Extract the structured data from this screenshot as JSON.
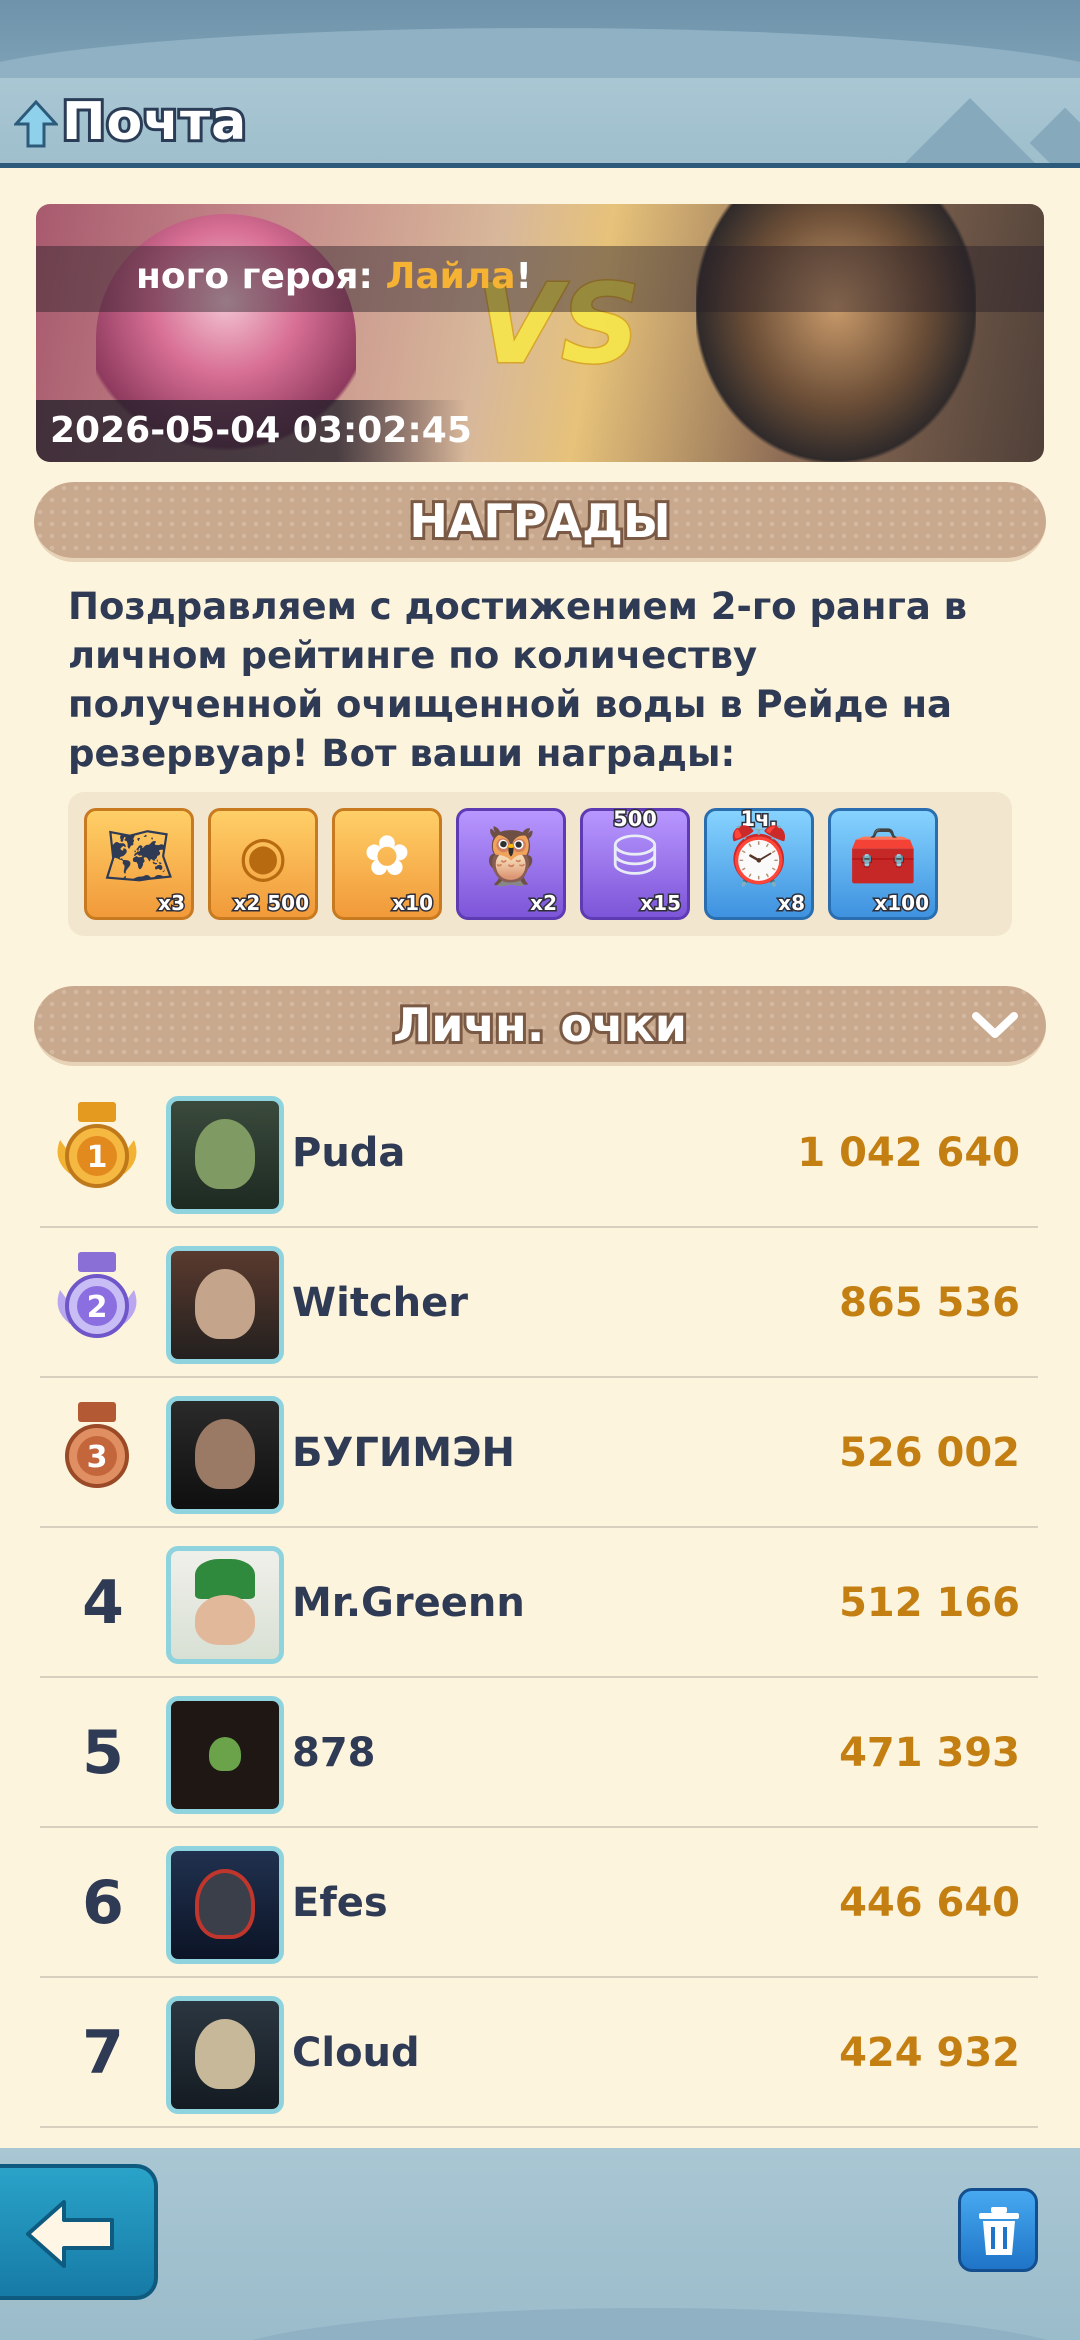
{
  "header": {
    "title": "Почта"
  },
  "banner": {
    "caption_prefix": "ного героя: ",
    "caption_highlight": "Лайла",
    "caption_suffix": "!",
    "vs_text": "VS",
    "date": "2026-05-04 03:02:45"
  },
  "rewards_section": {
    "title": "НАГРАДЫ",
    "message": "Поздравляем с достижением 2-го ранга в личном рейтинге по количеству полученной очищенной воды в Рейде на резервуар! Вот ваши награды:",
    "items": [
      {
        "icon": "map-scroll-icon",
        "style": "orange",
        "qty": "x3",
        "top": ""
      },
      {
        "icon": "gold-coin-icon",
        "style": "orange",
        "qty": "x2 500",
        "top": ""
      },
      {
        "icon": "gear-token-icon",
        "style": "orange",
        "qty": "x10",
        "top": ""
      },
      {
        "icon": "owl-pet-icon",
        "style": "purple",
        "qty": "x2",
        "top": ""
      },
      {
        "icon": "silver-coins-icon",
        "style": "purple",
        "qty": "x15",
        "top": "500"
      },
      {
        "icon": "speedup-clock-icon",
        "style": "blue",
        "qty": "x8",
        "top": "1ч."
      },
      {
        "icon": "resource-crate-icon",
        "style": "blue",
        "qty": "x100",
        "top": ""
      }
    ]
  },
  "leaderboard": {
    "title": "Личн. очки",
    "rows": [
      {
        "rank": "1",
        "name": "Puda",
        "score": "1 042 640"
      },
      {
        "rank": "2",
        "name": "Witcher",
        "score": "865 536"
      },
      {
        "rank": "3",
        "name": "БУГИМЭН",
        "score": "526 002"
      },
      {
        "rank": "4",
        "name": "Mr.Greenn",
        "score": "512 166"
      },
      {
        "rank": "5",
        "name": "878",
        "score": "471 393"
      },
      {
        "rank": "6",
        "name": "Efes",
        "score": "446 640"
      },
      {
        "rank": "7",
        "name": "Cloud",
        "score": "424 932"
      }
    ]
  },
  "colors": {
    "score": "#c47f12",
    "gold_medal": "#f2b233",
    "silver_medal": "#9a84e0",
    "bronze_medal": "#c9724a",
    "avatar_border": "#8fd3de"
  }
}
